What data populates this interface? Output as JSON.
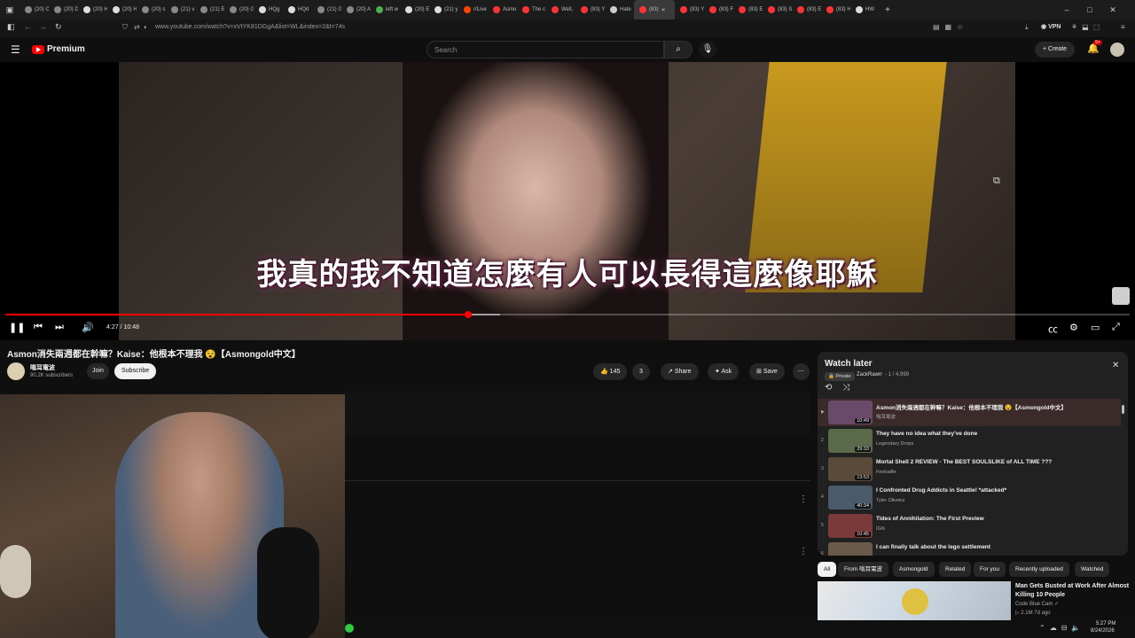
{
  "browser": {
    "tabs": [
      {
        "label": "(20) C",
        "color": "#888888"
      },
      {
        "label": "(20) D",
        "color": "#888888"
      },
      {
        "label": "(20) H",
        "color": "#dddddd"
      },
      {
        "label": "(20) H",
        "color": "#dddddd"
      },
      {
        "label": "(20) s",
        "color": "#888888"
      },
      {
        "label": "(21) v",
        "color": "#888888"
      },
      {
        "label": "(21) E",
        "color": "#888888"
      },
      {
        "label": "(20) G",
        "color": "#888888"
      },
      {
        "label": "HQg",
        "color": "#dddddd"
      },
      {
        "label": "HQd",
        "color": "#dddddd"
      },
      {
        "label": "(21) G",
        "color": "#888888"
      },
      {
        "label": "(20) A",
        "color": "#888888"
      },
      {
        "label": "left w",
        "color": "#4caf50"
      },
      {
        "label": "(20) E",
        "color": "#dddddd"
      },
      {
        "label": "(21) y",
        "color": "#dddddd"
      },
      {
        "label": "r/Live",
        "color": "#ff4500"
      },
      {
        "label": "Asmo",
        "color": "#ff3333"
      },
      {
        "label": "The c",
        "color": "#ff3333"
      },
      {
        "label": "Well,",
        "color": "#ff3333"
      },
      {
        "label": "(83) Y",
        "color": "#ff3333"
      },
      {
        "label": "Hate",
        "color": "#cccccc"
      },
      {
        "label": "(83)",
        "color": "#ff3333",
        "active": true
      },
      {
        "label": "(83) Y",
        "color": "#ff3333"
      },
      {
        "label": "(83) F",
        "color": "#ff3333"
      },
      {
        "label": "(83) E",
        "color": "#ff3333"
      },
      {
        "label": "(83) S",
        "color": "#ff3333"
      },
      {
        "label": "(83) E",
        "color": "#ff3333"
      },
      {
        "label": "(83) H",
        "color": "#ff3333"
      },
      {
        "label": "HW",
        "color": "#dddddd"
      }
    ],
    "url": "www.youtube.com/watch?v=xVtYK81DGgA&list=WL&index=2&t=74s",
    "vpn_label": "VPN"
  },
  "header": {
    "brand": "Premium",
    "search_placeholder": "Search",
    "create_label": "+ Create",
    "notif_count": "9+"
  },
  "player": {
    "subtitle": "我真的我不知道怎麼有人可以長得這麼像耶穌",
    "time": "4:27 / 10:48",
    "progress_fraction": 0.412,
    "buffer_fraction": 0.44
  },
  "video": {
    "title": "Asmon消失兩週都在幹嘛？Kaise：他根本不理我 😵【Asmongold中文】",
    "channel": "嗡耳電波",
    "subscribers": "90.2K subscribers",
    "join_label": "Join",
    "subscribe_label": "Subscribe",
    "likes": "145",
    "dislikes": "3",
    "share_label": "Share",
    "ask_label": "Ask",
    "save_label": "Save"
  },
  "watch_later": {
    "title": "Watch later",
    "privacy": "Private",
    "owner": "ZackRawrr",
    "count": "- 1 / 4,999",
    "items": [
      {
        "index": "▶",
        "title": "Asmon消失兩週都在幹嘛？Kaise：他根本不理我 😵【Asmongold中文】",
        "channel": "嗡耳電波",
        "duration": "10:49",
        "thumb": "#6a4a6a"
      },
      {
        "index": "2",
        "title": "They have no idea what they've done",
        "channel": "Legendary Drops",
        "duration": "29:33",
        "thumb": "#5a6a4a"
      },
      {
        "index": "3",
        "title": "Mortal Shell 2 REVIEW - The BEST SOULSLIKE of ALL TIME ???",
        "channel": "Fextralife",
        "duration": "13:53",
        "thumb": "#5a4a3a"
      },
      {
        "index": "4",
        "title": "I Confronted Drug Addicts in Seattle! *attacked*",
        "channel": "Tyler Oliveira",
        "duration": "40:34",
        "thumb": "#4a5a6a"
      },
      {
        "index": "5",
        "title": "Tides of Annihilation: The First Preview",
        "channel": "IGN",
        "duration": "10:45",
        "thumb": "#7a3a3a"
      },
      {
        "index": "6",
        "title": "I can finally talk about the lego settlement",
        "channel": "",
        "duration": "",
        "thumb": "#6a5a4a"
      }
    ]
  },
  "chips": [
    "All",
    "From 嗡耳電波",
    "Asmongold",
    "Related",
    "For you",
    "Recently uploaded",
    "Watched"
  ],
  "recommendation": {
    "title": "Man Gets Busted at Work After Almost Killing 10 People",
    "channel": "Code Blue Cam ✓",
    "meta": "▷ 2.1M  7d ago"
  },
  "taskbar": {
    "time": "5:27 PM",
    "date": "8/24/2026"
  }
}
